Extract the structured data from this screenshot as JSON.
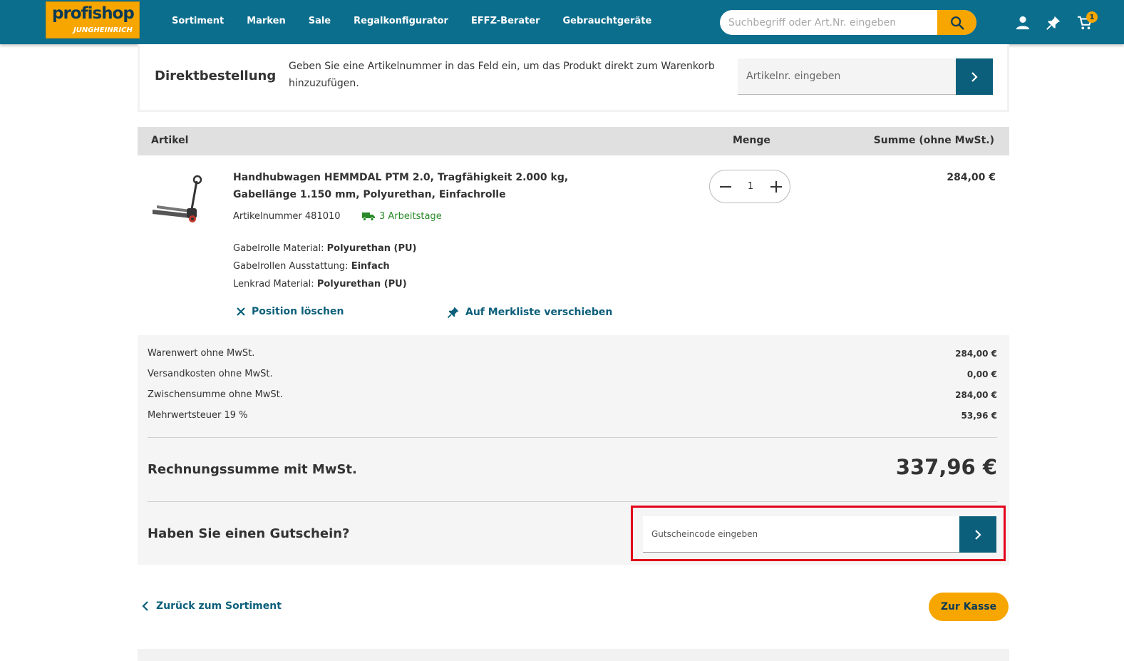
{
  "header": {
    "logo_text": "profishop",
    "logo_sub": "JUNGHEINRICH",
    "nav": [
      "Sortiment",
      "Marken",
      "Sale",
      "Regalkonfigurator",
      "EFFZ-Berater",
      "Gebrauchtgeräte"
    ],
    "search_placeholder": "Suchbegriff oder Art.Nr. eingeben",
    "cart_count": "1",
    "icons": [
      "search-icon",
      "user-icon",
      "pin-icon",
      "cart-icon"
    ],
    "colors": {
      "primary": "#0b6e8d",
      "accent": "#f7a600"
    }
  },
  "direct_order": {
    "title": "Direktbestellung",
    "description": "Geben Sie eine Artikelnummer in das Feld ein, um das Produkt direkt zum Warenkorb hinzuzufügen.",
    "placeholder": "Artikelnr. eingeben"
  },
  "table_header": {
    "article": "Artikel",
    "quantity": "Menge",
    "sum": "Summe (ohne MwSt.)"
  },
  "item": {
    "name": "Handhubwagen HEMMDAL PTM 2.0, Tragfähigkeit 2.000 kg, Gabellänge 1.150 mm, Polyurethan, Einfachrolle",
    "article_number": "Artikelnummer 481010",
    "delivery": "3 Arbeitstage",
    "attributes": [
      {
        "label": "Gabelrolle Material:",
        "value": "Polyurethan (PU)"
      },
      {
        "label": "Gabelrollen Ausstattung:",
        "value": "Einfach"
      },
      {
        "label": "Lenkrad Material:",
        "value": "Polyurethan (PU)"
      }
    ],
    "delete_label": "Position löschen",
    "wishlist_label": "Auf Merkliste verschieben",
    "quantity": "1",
    "price": "284,00 €"
  },
  "summary": {
    "rows": [
      {
        "label": "Warenwert ohne MwSt.",
        "value": "284,00 €"
      },
      {
        "label": "Versandkosten ohne MwSt.",
        "value": "0,00 €"
      },
      {
        "label": "Zwischensumme ohne MwSt.",
        "value": "284,00 €"
      },
      {
        "label": "Mehrwertsteuer 19 %",
        "value": "53,96 €"
      }
    ],
    "total_label": "Rechnungssumme mit MwSt.",
    "total_value": "337,96 €",
    "voucher_label": "Haben Sie einen Gutschein?",
    "voucher_placeholder": "Gutscheincode eingeben"
  },
  "footer": {
    "back_label": "Zurück zum Sortiment",
    "checkout_label": "Zur Kasse"
  }
}
